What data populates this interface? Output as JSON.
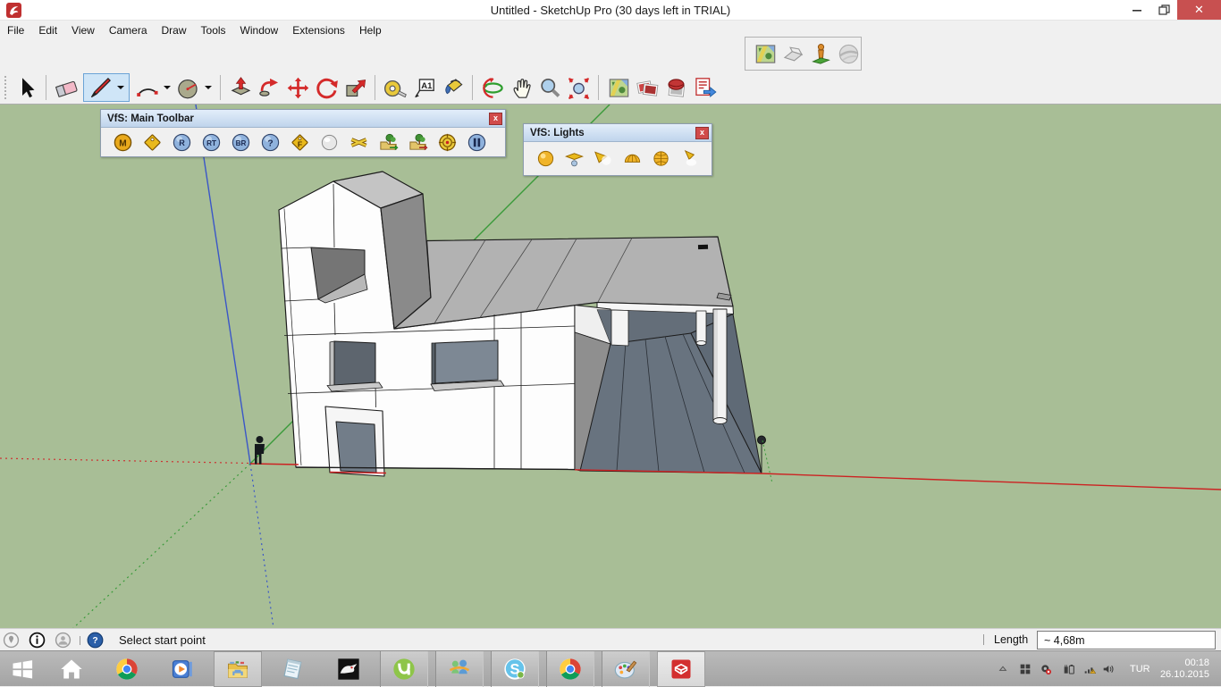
{
  "window": {
    "title": "Untitled - SketchUp Pro (30 days left in TRIAL)",
    "controls": [
      "minimize",
      "restore",
      "close"
    ]
  },
  "menus": [
    "File",
    "Edit",
    "View",
    "Camera",
    "Draw",
    "Tools",
    "Window",
    "Extensions",
    "Help"
  ],
  "toolbar": {
    "items": [
      "select",
      "sep",
      "eraser",
      "linegroup",
      "arc",
      "dd",
      "circle",
      "dd",
      "sep",
      "pushpull",
      "followme",
      "move",
      "rotate",
      "scale",
      "sep",
      "tape",
      "text",
      "paint",
      "sep",
      "orbit",
      "pan",
      "zoom",
      "zoomext",
      "sep",
      "maploc",
      "phototex",
      "photomatch",
      "exportdoc"
    ],
    "selected_tool": "line"
  },
  "location_toolbar": {
    "icons": [
      "maploc",
      "terrain",
      "personfig",
      "globe"
    ]
  },
  "vfs_main": {
    "title": "VfS: Main Toolbar",
    "icons": [
      "vm_m",
      "vm_tag",
      "vm_r",
      "vm_rt",
      "vm_br",
      "vm_q",
      "vm_ftag",
      "vm_sphere",
      "vm_cross",
      "vm_tree_g",
      "vm_tree_r",
      "vm_target",
      "vm_pause"
    ]
  },
  "vfs_lights": {
    "title": "VfS: Lights",
    "icons": [
      "li_omni",
      "li_rect",
      "li_spot",
      "li_dome",
      "li_ies",
      "li_down"
    ]
  },
  "statusbar": {
    "icons": [
      "st_geo",
      "st_info",
      "st_person"
    ],
    "help_icon": "st_q",
    "message": "Select start point",
    "length_label": "Length",
    "length_value": "~ 4,68m"
  },
  "taskbar": {
    "items": [
      "start",
      "home",
      "chrome",
      "wmp",
      "explorer",
      "notepad",
      "rhino",
      "utorrent",
      "messenger",
      "skype",
      "chrome2",
      "paint",
      "sketchup"
    ],
    "tray_icons": [
      "tray_up",
      "tray_win",
      "tray_eject",
      "tray_power",
      "tray_net",
      "tray_vol"
    ],
    "lang": "TUR",
    "time": "00:18",
    "date": "26.10.2015"
  },
  "colors": {
    "viewport_bg": "#a8be96",
    "axis_red": "#cc2222",
    "axis_green": "#3a9a3a",
    "axis_blue": "#3a56c8",
    "close_button": "#c85050",
    "selection_highlight": "#cfe5f7"
  }
}
